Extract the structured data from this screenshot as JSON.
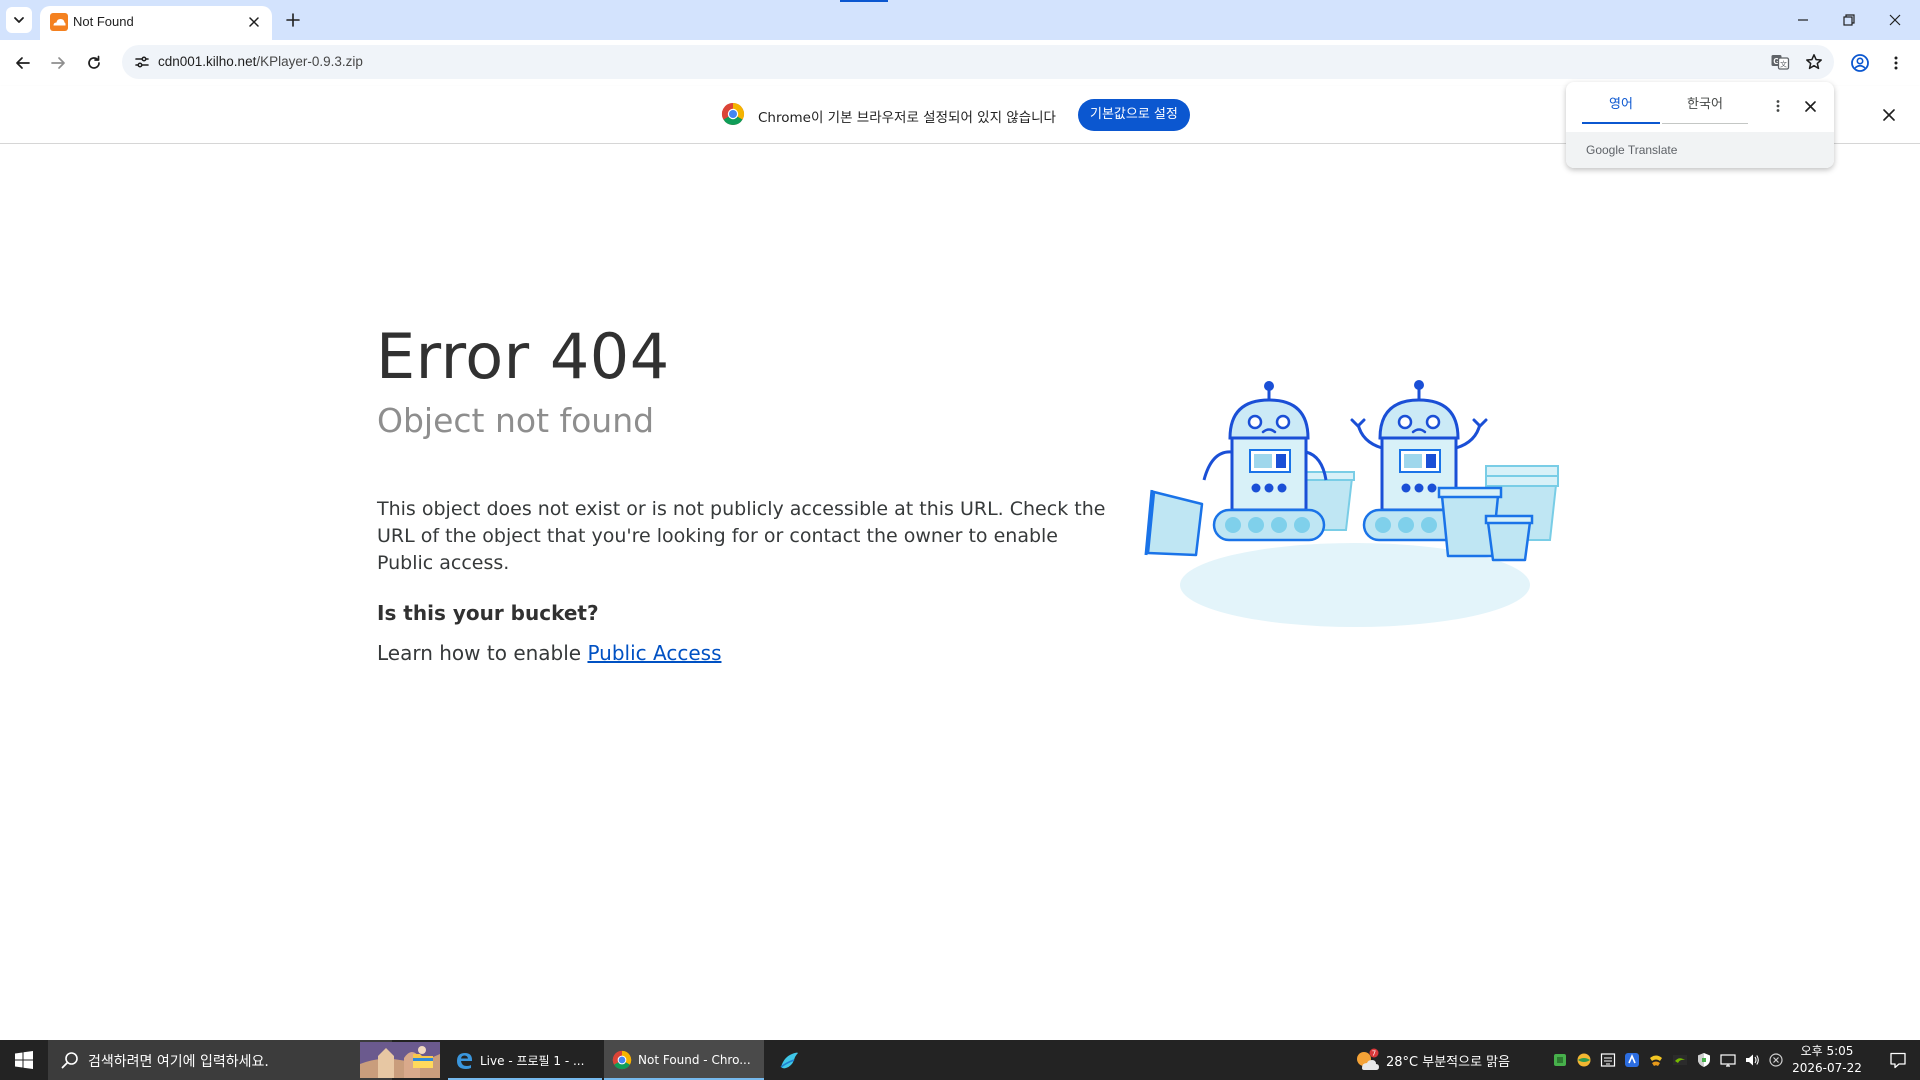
{
  "browser": {
    "tab_title": "Not Found",
    "url_host": "cdn001.kilho.net",
    "url_path": "/KPlayer-0.9.3.zip"
  },
  "infobar": {
    "message": "Chrome이 기본 브라우저로 설정되어 있지 않습니다",
    "button_label": "기본값으로 설정"
  },
  "translate": {
    "source_language": "영어",
    "target_language": "한국어",
    "brand_google": "Google",
    "brand_translate": "Translate"
  },
  "page": {
    "title": "Error 404",
    "subtitle": "Object not found",
    "description": "This object does not exist or is not publicly accessible at this URL. Check the URL of the object that you're looking for or contact the owner to enable Public access.",
    "bucket_heading": "Is this your bucket?",
    "learn_prefix": "Learn how to enable ",
    "learn_link": "Public Access"
  },
  "taskbar": {
    "search_placeholder": "검색하려면 여기에 입력하세요.",
    "apps": [
      {
        "label": "",
        "icon": "file-explorer-icon"
      },
      {
        "label": "Live - 프로필 1 - ...",
        "icon": "edge-legacy-icon"
      },
      {
        "label": "Not Found - Chro...",
        "icon": "chrome-icon"
      },
      {
        "label": "",
        "icon": "bird-app-icon"
      }
    ],
    "weather_badge": "7",
    "weather": "28°C  부분적으로 맑음",
    "clock_time": "오후 5:05",
    "clock_date": "2026-07-22"
  },
  "colors": {
    "accent_blue": "#0b57d0",
    "tabstrip_bg": "#d3e3fd",
    "link_blue": "#0051c3",
    "taskbar_bg": "#232323",
    "cloudflare_orange": "#f48120"
  }
}
